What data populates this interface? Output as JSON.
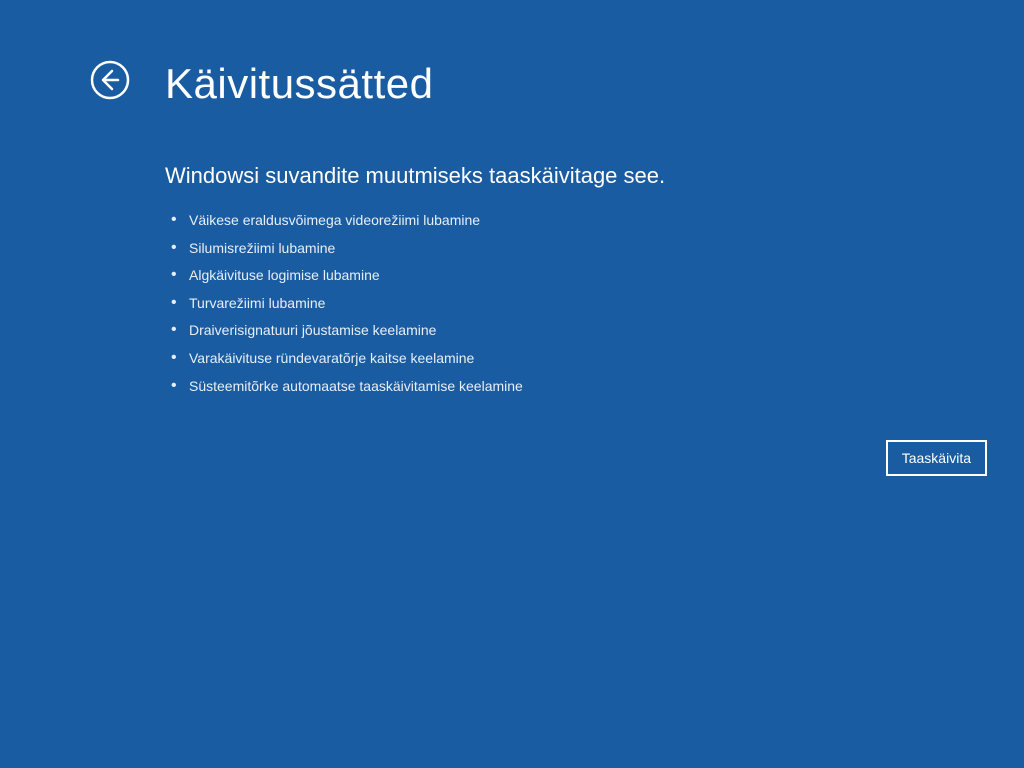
{
  "title": "Käivitussätted",
  "subtitle": "Windowsi suvandite muutmiseks taaskäivitage see.",
  "options": [
    "Väikese eraldusvõimega videorežiimi lubamine",
    "Silumisrežiimi lubamine",
    "Algkäivituse logimise lubamine",
    "Turvarežiimi lubamine",
    "Draiverisignatuuri jõustamise keelamine",
    "Varakäivituse ründevaratõrje kaitse keelamine",
    "Süsteemitõrke automaatse taaskäivitamise keelamine"
  ],
  "restart_label": "Taaskäivita"
}
